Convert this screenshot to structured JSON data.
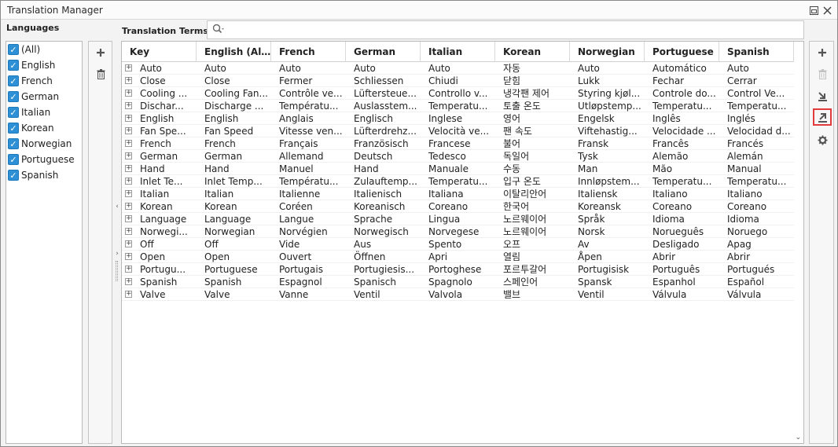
{
  "window": {
    "title": "Translation Manager"
  },
  "languages": {
    "label": "Languages",
    "items": [
      "(All)",
      "English",
      "French",
      "German",
      "Italian",
      "Korean",
      "Norwegian",
      "Portuguese",
      "Spanish"
    ]
  },
  "terms": {
    "label": "Translation Terms",
    "search": {
      "value": "",
      "placeholder": ""
    },
    "columns": [
      "Key",
      "English (Al…",
      "French",
      "German",
      "Italian",
      "Korean",
      "Norwegian",
      "Portuguese",
      "Spanish"
    ],
    "rows": [
      [
        "Auto",
        "Auto",
        "Auto",
        "Auto",
        "Auto",
        "자동",
        "Auto",
        "Automático",
        "Auto"
      ],
      [
        "Close",
        "Close",
        "Fermer",
        "Schliessen",
        "Chiudi",
        "닫힘",
        "Lukk",
        "Fechar",
        "Cerrar"
      ],
      [
        "Cooling ...",
        "Cooling Fan...",
        "Contrôle ve...",
        "Lüftersteue...",
        "Controllo v...",
        "냉각팬 제어",
        "Styring kjøl...",
        "Controle do...",
        "Control Ve..."
      ],
      [
        "Dischar...",
        "Discharge ...",
        "Températu...",
        "Auslasstem...",
        "Temperatu...",
        "토출 온도",
        "Utløpstemp...",
        "Temperatu...",
        "Temperatu..."
      ],
      [
        "English",
        "English",
        "Anglais",
        "Englisch",
        "Inglese",
        "영어",
        "Engelsk",
        "Inglês",
        "Inglés"
      ],
      [
        "Fan Spe...",
        "Fan Speed",
        "Vitesse ven...",
        "Lüfterdrehz...",
        "Velocità ve...",
        "팬 속도",
        "Viftehastig...",
        "Velocidade ...",
        "Velocidad d..."
      ],
      [
        "French",
        "French",
        "Français",
        "Französisch",
        "Francese",
        "불어",
        "Fransk",
        "Francês",
        "Francés"
      ],
      [
        "German",
        "German",
        "Allemand",
        "Deutsch",
        "Tedesco",
        "독일어",
        "Tysk",
        "Alemão",
        "Alemán"
      ],
      [
        "Hand",
        "Hand",
        "Manuel",
        "Hand",
        "Manuale",
        "수동",
        "Man",
        "Mão",
        "Manual"
      ],
      [
        "Inlet Te...",
        "Inlet Temp...",
        "Températu...",
        "Zulauftemp...",
        "Temperatu...",
        "입구 온도",
        "Innløpstem...",
        "Temperatu...",
        "Temperatu..."
      ],
      [
        "Italian",
        "Italian",
        "Italienne",
        "Italienisch",
        "Italiana",
        "이탈리안어",
        "Italiensk",
        "Italiano",
        "Italiano"
      ],
      [
        "Korean",
        "Korean",
        "Coréen",
        "Koreanisch",
        "Coreano",
        "한국어",
        "Koreansk",
        "Coreano",
        "Coreano"
      ],
      [
        "Language",
        "Language",
        "Langue",
        "Sprache",
        "Lingua",
        "노르웨이어",
        "Språk",
        "Idioma",
        "Idioma"
      ],
      [
        "Norwegi...",
        "Norwegian",
        "Norvégien",
        "Norwegisch",
        "Norvegese",
        "노르웨이어",
        "Norsk",
        "Norueguês",
        "Noruego"
      ],
      [
        "Off",
        "Off",
        "Vide",
        "Aus",
        "Spento",
        "오프",
        "Av",
        "Desligado",
        "Apag"
      ],
      [
        "Open",
        "Open",
        "Ouvert",
        "Öffnen",
        "Apri",
        "열림",
        "Åpen",
        "Abrir",
        "Abrir"
      ],
      [
        "Portugu...",
        "Portuguese",
        "Portugais",
        "Portugiesis...",
        "Portoghese",
        "포르투갈어",
        "Portugisisk",
        "Português",
        "Portugués"
      ],
      [
        "Spanish",
        "Spanish",
        "Espagnol",
        "Spanisch",
        "Spagnolo",
        "스페인어",
        "Spansk",
        "Espanhol",
        "Español"
      ],
      [
        "Valve",
        "Valve",
        "Vanne",
        "Ventil",
        "Valvola",
        "밸브",
        "Ventil",
        "Válvula",
        "Válvula"
      ]
    ]
  },
  "icons": {
    "restore": "restore-icon",
    "close": "close-icon",
    "search": "search-icon",
    "add": "plus-icon",
    "delete": "trash-icon",
    "import": "import-icon",
    "export": "export-icon",
    "settings": "gear-icon",
    "expander": "plus-box-icon"
  },
  "colors": {
    "checkbox": "#2d8fd5",
    "highlight": "#e23b3b"
  }
}
